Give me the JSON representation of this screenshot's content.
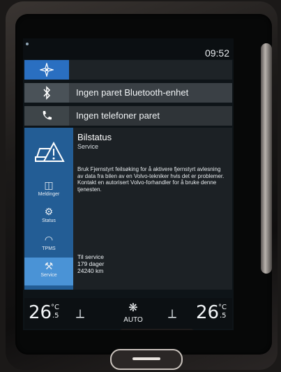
{
  "statusbar": {
    "time": "09:52"
  },
  "tiles": {
    "navigation": {
      "icon": "navigation-icon"
    },
    "bluetooth": {
      "icon": "bluetooth-icon",
      "label": "Ingen paret Bluetooth-enhet"
    },
    "phone": {
      "icon": "phone-icon",
      "label": "Ingen telefoner paret"
    }
  },
  "car_status": {
    "title": "Bilstatus",
    "subtitle": "Service",
    "body": "Bruk Fjernstyrt feilsøking for å aktivere fjernstyrt avlesning av data fra bilen av en Volvo-tekniker hvis det er problemer. Kontakt en autorisert Volvo-forhandler for å bruke denne tjenesten.",
    "service_heading": "Til service",
    "service_days": "179 dager",
    "service_km": "24240 km",
    "sidebar": [
      {
        "label": "Meldinger",
        "icon": "messages-icon"
      },
      {
        "label": "Status",
        "icon": "status-icon"
      },
      {
        "label": "TPMS",
        "icon": "tpms-icon"
      },
      {
        "label": "Service",
        "icon": "service-icon",
        "active": true
      }
    ]
  },
  "climate": {
    "left_temp": "26",
    "left_unit": "°C",
    "left_decimal": ".5",
    "right_temp": "26",
    "right_unit": "°C",
    "right_decimal": ".5",
    "fan_mode": "AUTO"
  },
  "colors": {
    "accent": "#4a93d6",
    "sidebar": "#235d95",
    "nav_icon_bg": "#2a6fc1"
  }
}
